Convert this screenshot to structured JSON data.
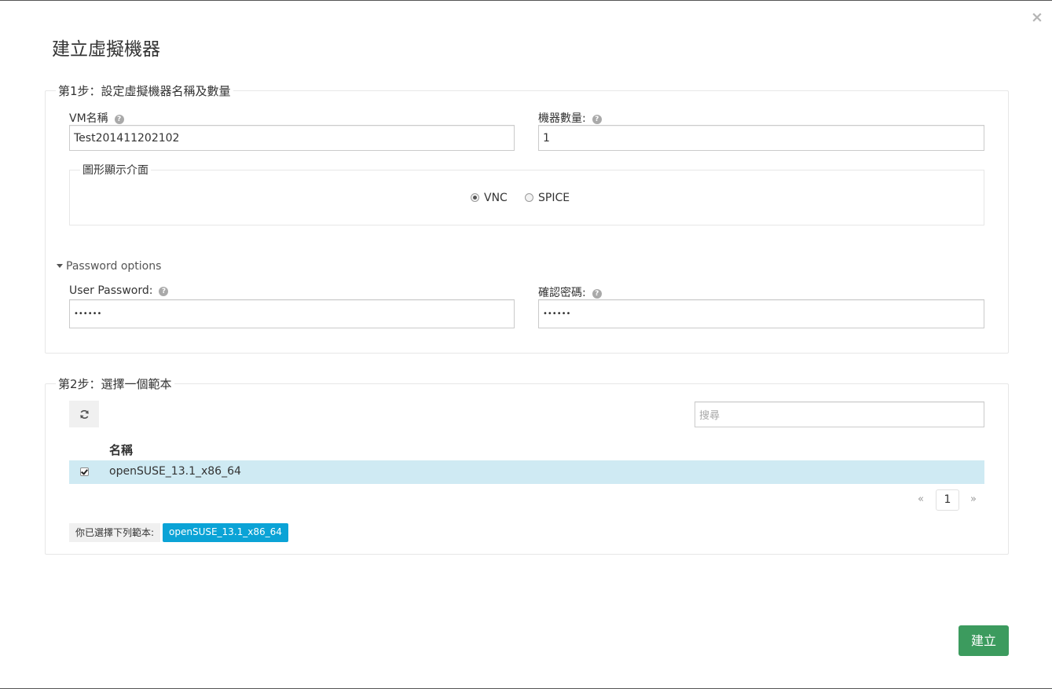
{
  "dialog": {
    "title": "建立虛擬機器",
    "close_label": "×"
  },
  "step1": {
    "legend": "第1步：設定虛擬機器名稱及數量",
    "vm_name_label": "VM名稱",
    "vm_name_value": "Test201411202102",
    "count_label": "機器數量:",
    "count_value": "1",
    "display": {
      "legend": "圖形顯示介面",
      "options": [
        {
          "label": "VNC",
          "selected": true
        },
        {
          "label": "SPICE",
          "selected": false
        }
      ]
    },
    "password_toggle": "Password options",
    "user_password_label": "User Password:",
    "user_password_value": "••••••",
    "confirm_password_label": "確認密碼:",
    "confirm_password_value": "••••••"
  },
  "step2": {
    "legend": "第2步：選擇一個範本",
    "search_placeholder": "搜尋",
    "column_name": "名稱",
    "rows": [
      {
        "name": "openSUSE_13.1_x86_64",
        "checked": true
      }
    ],
    "pager": {
      "prev": "«",
      "current": "1",
      "next": "»"
    },
    "selected_label": "你已選擇下列範本:",
    "selected_tag": "openSUSE_13.1_x86_64"
  },
  "footer": {
    "create_label": "建立"
  },
  "colors": {
    "create_button": "#3c9b5e",
    "selected_row": "#cfeaf3",
    "selected_tag": "#0ba3d6"
  },
  "icons": {
    "help": "question-circle-icon",
    "refresh": "refresh-icon",
    "close": "close-icon",
    "caret": "caret-down-icon"
  }
}
